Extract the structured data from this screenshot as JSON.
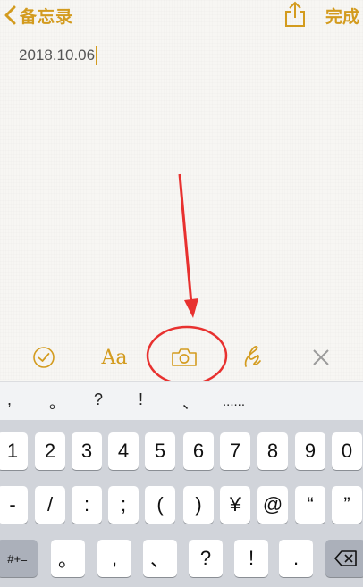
{
  "colors": {
    "accent": "#d39b1e",
    "annotation": "#e8312f"
  },
  "nav": {
    "back_label": "备忘录",
    "share_icon": "share-icon",
    "done_label": "完成"
  },
  "note": {
    "text": "2018.10.06"
  },
  "toolbar": {
    "checklist_icon": "checklist-icon",
    "format_label": "Aa",
    "camera_icon": "camera-icon",
    "sketch_icon": "sketch-icon",
    "close_icon": "close-icon"
  },
  "suggestions": [
    ",",
    "。",
    "?",
    "!",
    "、",
    "......"
  ],
  "keyboard": {
    "row1": [
      "1",
      "2",
      "3",
      "4",
      "5",
      "6",
      "7",
      "8",
      "9",
      "0"
    ],
    "row2": [
      "-",
      "/",
      ":",
      ";",
      "(",
      ")",
      "¥",
      "@",
      "“",
      "”"
    ],
    "row3_mode": "#+=",
    "row3": [
      "。",
      ",",
      "、",
      "?",
      "!",
      "."
    ],
    "delete_icon": "delete-icon"
  }
}
